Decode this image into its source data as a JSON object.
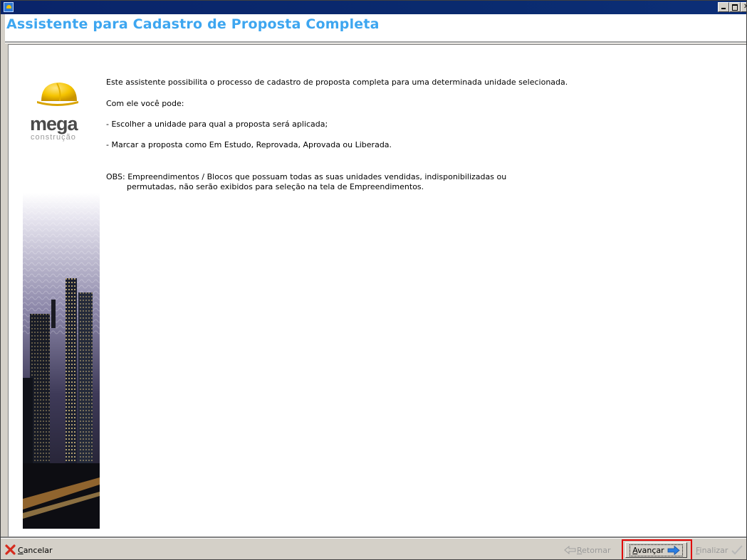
{
  "window": {
    "title_bar_text": "",
    "controls": [
      "minimize-icon",
      "maximize-icon",
      "close-icon"
    ]
  },
  "header": {
    "title": "Assistente para Cadastro de Proposta Completa"
  },
  "sidebar": {
    "logo_text": "mega",
    "logo_subtext": "construção"
  },
  "content": {
    "intro": "Este assistente possibilita o processo de cadastro de proposta completa para uma determinada unidade selecionada.",
    "with_it": "Com ele você pode:",
    "bullet1": "- Escolher a unidade para qual a proposta será aplicada;",
    "bullet2": "- Marcar a proposta como Em Estudo, Reprovada, Aprovada ou Liberada.",
    "obs_line1": "OBS: Empreendimentos / Blocos que possuam todas as suas unidades vendidas, indisponibilizadas ou",
    "obs_line2": "permutadas, não serão exibidos para seleção na tela de Empreendimentos."
  },
  "footer": {
    "cancel_label_first": "C",
    "cancel_label_rest": "ancelar",
    "back_label_first": "R",
    "back_label_rest": "etornar",
    "next_label_first": "A",
    "next_label_rest": "vançar",
    "finish_label_first": "F",
    "finish_label_rest": "inalizar"
  },
  "colors": {
    "title_blue": "#3da6f0",
    "titlebar": "#0a246a",
    "highlight_red": "#e00000",
    "cancel_red": "#d52b1e",
    "arrow_blue": "#2a7de1"
  }
}
